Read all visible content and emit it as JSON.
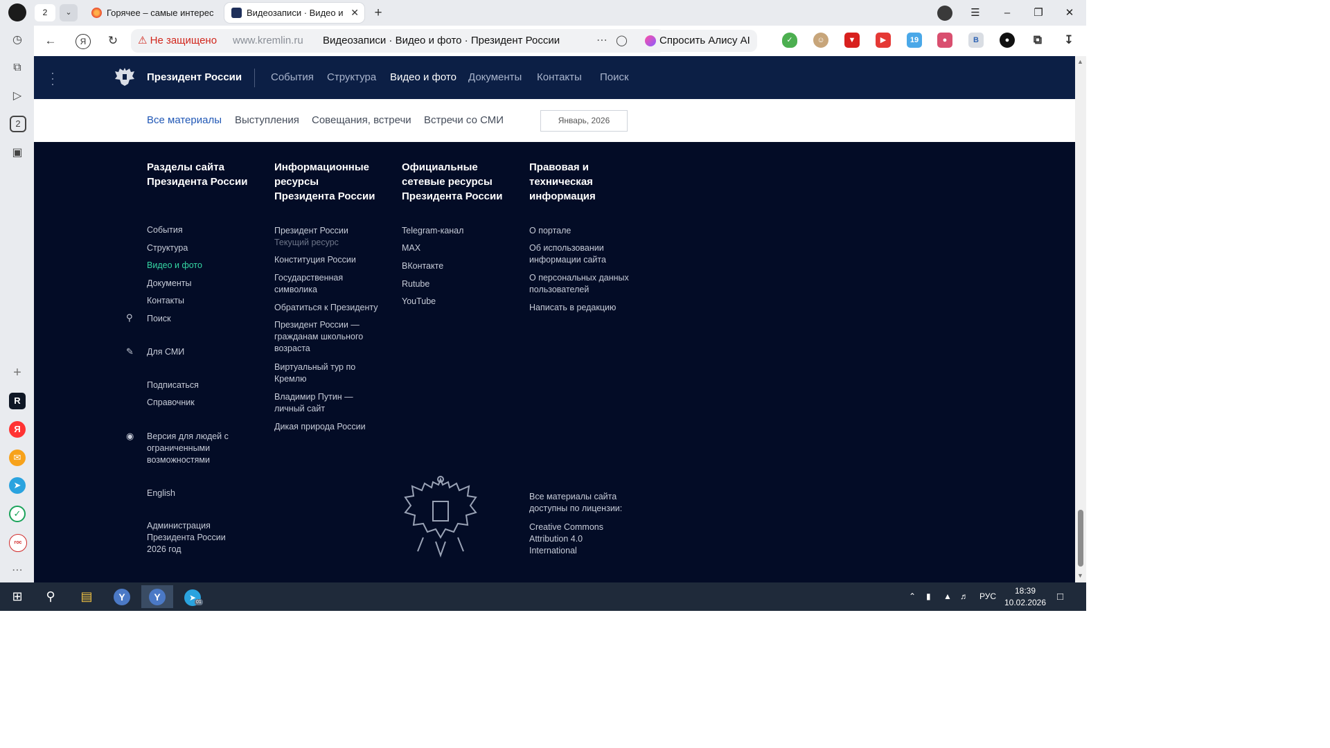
{
  "browser": {
    "tab_counter": "2",
    "tabs": [
      {
        "title": "Горячее – самые интерес",
        "active": false
      },
      {
        "title": "Видеозаписи · Видео и",
        "active": true
      }
    ],
    "new_tab_symbol": "+",
    "security_warning": "Не защищено",
    "address_host": "www.kremlin.ru",
    "page_title": "Видеозаписи · Видео и фото · Президент России",
    "alice_button": "Спросить Алису AI",
    "ext_badges": {
      "weather": "19",
      "vk": "B"
    }
  },
  "site": {
    "brand": "Президент России",
    "nav": [
      {
        "label": "События",
        "active": false
      },
      {
        "label": "Структура",
        "active": false
      },
      {
        "label": "Видео и фото",
        "active": true
      },
      {
        "label": "Документы",
        "active": false
      },
      {
        "label": "Контакты",
        "active": false
      },
      {
        "label": "Поиск",
        "active": false
      }
    ],
    "subnav": [
      {
        "label": "Все материалы",
        "active": true
      },
      {
        "label": "Выступления",
        "active": false
      },
      {
        "label": "Совещания, встречи",
        "active": false
      },
      {
        "label": "Встречи со СМИ",
        "active": false
      }
    ],
    "date_filter": "Январь, 2026"
  },
  "footer": {
    "col1": {
      "heading": "Разделы сайта Президента России",
      "links": [
        "События",
        "Структура",
        "Видео и фото",
        "Документы",
        "Контакты"
      ],
      "search": "Поиск",
      "press": "Для СМИ",
      "subscribe": "Подписаться",
      "reference": "Справочник",
      "accessibility": "Версия для людей с ограниченными возможностями",
      "english": "English",
      "admin_line1": "Администрация",
      "admin_line2": "Президента России",
      "admin_line3": "2026 год"
    },
    "col2": {
      "heading": "Информационные ресурсы Президента России",
      "current_label": "Президент России",
      "current_sub": "Текущий ресурс",
      "links": [
        "Конституция России",
        "Государственная символика",
        "Обратиться к Президенту",
        "Президент России — гражданам школьного возраста",
        "Виртуальный тур по Кремлю",
        "Владимир Путин — личный сайт",
        "Дикая природа России"
      ]
    },
    "col3": {
      "heading": "Официальные сетевые ресурсы Президента России",
      "links": [
        "Telegram-канал",
        "MAX",
        "ВКонтакте",
        "Rutube",
        "YouTube"
      ]
    },
    "col4": {
      "heading": "Правовая и техническая информация",
      "links": [
        "О портале",
        "Об использовании информации сайта",
        "О персональных данных пользователей",
        "Написать в редакцию"
      ],
      "license_intro": "Все материалы сайта доступны по лицензии:",
      "license_link": "Creative Commons Attribution 4.0 International"
    }
  },
  "taskbar": {
    "telegram_badge": "01",
    "language": "РУС",
    "time": "18:39",
    "date": "10.02.2026"
  },
  "colors": {
    "site_header": "#0c1f45",
    "footer_bg": "#030c26",
    "active_footer_link": "#35d7a4",
    "active_subnav": "#2158b6",
    "security_warning": "#d1261b"
  }
}
